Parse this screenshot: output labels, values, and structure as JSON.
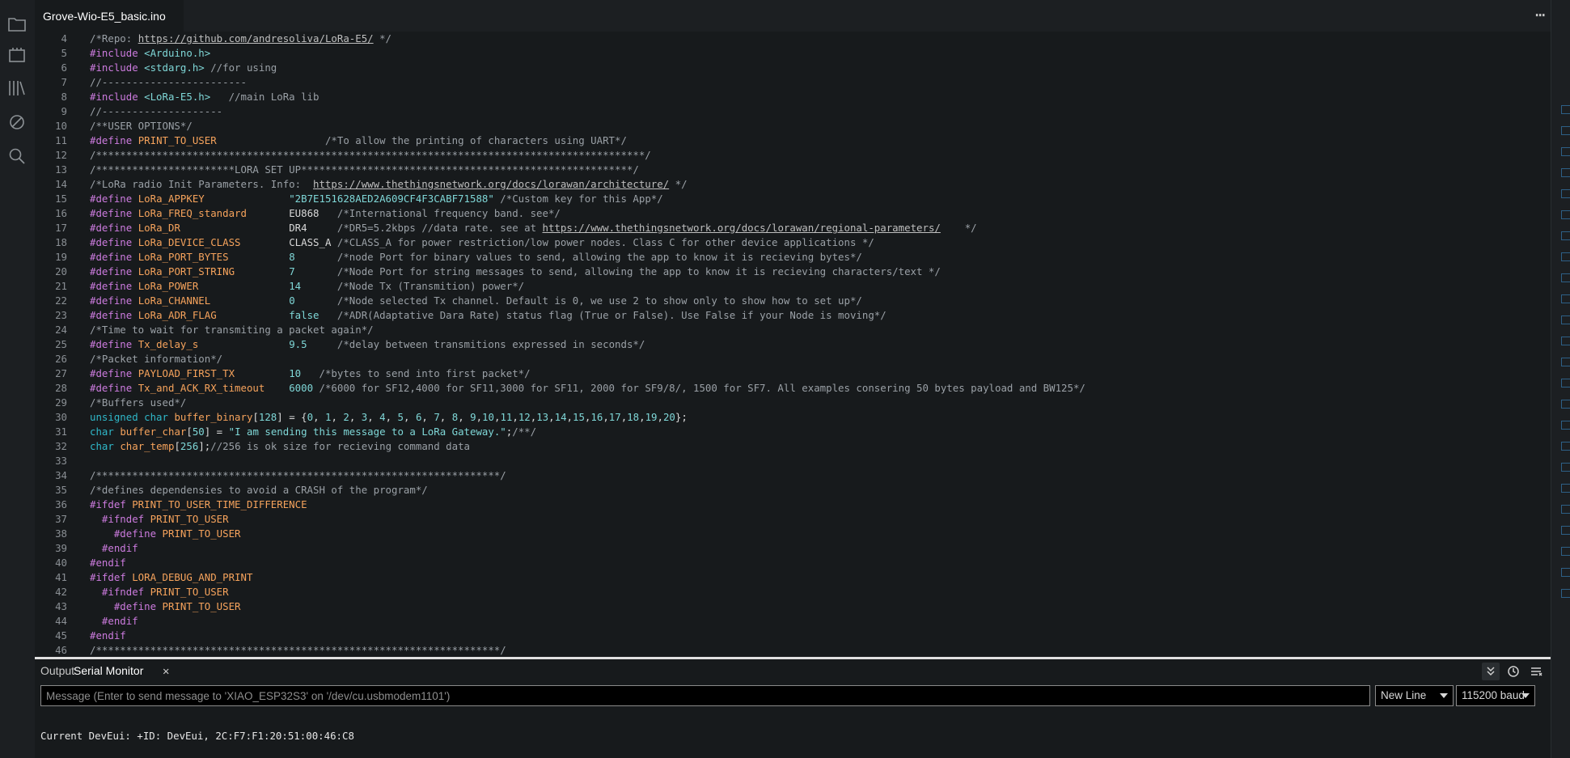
{
  "sidebar": {
    "icons": [
      "folder-icon",
      "board-icon",
      "library-icon",
      "debug-icon",
      "search-icon"
    ]
  },
  "editor": {
    "tab_label": "Grove-Wio-E5_basic.ino",
    "more_label": "⋯",
    "lines": [
      {
        "n": "4",
        "t": [
          [
            "c",
            "/*Repo: "
          ],
          [
            "u",
            "https://github.com/andresoliva/LoRa-E5/"
          ],
          [
            "c",
            " */"
          ]
        ]
      },
      {
        "n": "5",
        "t": [
          [
            "pp",
            "#include "
          ],
          [
            "str",
            "<Arduino.h>"
          ]
        ]
      },
      {
        "n": "6",
        "t": [
          [
            "pp",
            "#include "
          ],
          [
            "str",
            "<stdarg.h>"
          ],
          [
            "c",
            " //for using"
          ]
        ]
      },
      {
        "n": "7",
        "t": [
          [
            "c",
            "//------------------------"
          ]
        ]
      },
      {
        "n": "8",
        "t": [
          [
            "pp",
            "#include "
          ],
          [
            "str",
            "<LoRa-E5.h>"
          ],
          [
            "c",
            "   //main LoRa lib"
          ]
        ]
      },
      {
        "n": "9",
        "t": [
          [
            "c",
            "//--------------------"
          ]
        ]
      },
      {
        "n": "10",
        "t": [
          [
            "c",
            "/**USER OPTIONS*/"
          ]
        ]
      },
      {
        "n": "11",
        "t": [
          [
            "pp",
            "#define "
          ],
          [
            "name",
            "PRINT_TO_USER"
          ],
          [
            "c",
            "                  /*To allow the printing of characters using UART*/"
          ]
        ]
      },
      {
        "n": "12",
        "t": [
          [
            "c",
            "/*******************************************************************************************/"
          ]
        ]
      },
      {
        "n": "13",
        "t": [
          [
            "c",
            "/***********************LORA SET UP*******************************************************/"
          ]
        ]
      },
      {
        "n": "14",
        "t": [
          [
            "c",
            "/*LoRa radio Init Parameters. Info:  "
          ],
          [
            "u",
            "https://www.thethingsnetwork.org/docs/lorawan/architecture/"
          ],
          [
            "c",
            " */"
          ]
        ]
      },
      {
        "n": "15",
        "t": [
          [
            "pp",
            "#define "
          ],
          [
            "name",
            "LoRa_APPKEY              "
          ],
          [
            "str",
            "\"2B7E151628AED2A609CF4F3CABF71588\""
          ],
          [
            "c",
            " /*Custom key for this App*/"
          ]
        ]
      },
      {
        "n": "16",
        "t": [
          [
            "pp",
            "#define "
          ],
          [
            "name",
            "LoRa_FREQ_standard       "
          ],
          [
            "plain",
            "EU868"
          ],
          [
            "c",
            "   /*International frequency band. see*/"
          ]
        ]
      },
      {
        "n": "17",
        "t": [
          [
            "pp",
            "#define "
          ],
          [
            "name",
            "LoRa_DR                  "
          ],
          [
            "plain",
            "DR4"
          ],
          [
            "c",
            "     /*DR5=5.2kbps //data rate. see at "
          ],
          [
            "u",
            "https://www.thethingsnetwork.org/docs/lorawan/regional-parameters/"
          ],
          [
            "c",
            "    */"
          ]
        ]
      },
      {
        "n": "18",
        "t": [
          [
            "pp",
            "#define "
          ],
          [
            "name",
            "LoRa_DEVICE_CLASS        "
          ],
          [
            "plain",
            "CLASS_A"
          ],
          [
            "c",
            " /*CLASS_A for power restriction/low power nodes. Class C for other device applications */"
          ]
        ]
      },
      {
        "n": "19",
        "t": [
          [
            "pp",
            "#define "
          ],
          [
            "name",
            "LoRa_PORT_BYTES          "
          ],
          [
            "num",
            "8"
          ],
          [
            "c",
            "       /*node Port for binary values to send, allowing the app to know it is recieving bytes*/"
          ]
        ]
      },
      {
        "n": "20",
        "t": [
          [
            "pp",
            "#define "
          ],
          [
            "name",
            "LoRa_PORT_STRING         "
          ],
          [
            "num",
            "7"
          ],
          [
            "c",
            "       /*Node Port for string messages to send, allowing the app to know it is recieving characters/text */"
          ]
        ]
      },
      {
        "n": "21",
        "t": [
          [
            "pp",
            "#define "
          ],
          [
            "name",
            "LoRa_POWER               "
          ],
          [
            "num",
            "14"
          ],
          [
            "c",
            "      /*Node Tx (Transmition) power*/"
          ]
        ]
      },
      {
        "n": "22",
        "t": [
          [
            "pp",
            "#define "
          ],
          [
            "name",
            "LoRa_CHANNEL             "
          ],
          [
            "num",
            "0"
          ],
          [
            "c",
            "       /*Node selected Tx channel. Default is 0, we use 2 to show only to show how to set up*/"
          ]
        ]
      },
      {
        "n": "23",
        "t": [
          [
            "pp",
            "#define "
          ],
          [
            "name",
            "LoRa_ADR_FLAG            "
          ],
          [
            "num",
            "false"
          ],
          [
            "c",
            "   /*ADR(Adaptative Dara Rate) status flag (True or False). Use False if your Node is moving*/"
          ]
        ]
      },
      {
        "n": "24",
        "t": [
          [
            "c",
            "/*Time to wait for transmiting a packet again*/"
          ]
        ]
      },
      {
        "n": "25",
        "t": [
          [
            "pp",
            "#define "
          ],
          [
            "name",
            "Tx_delay_s               "
          ],
          [
            "num",
            "9.5"
          ],
          [
            "c",
            "     /*delay between transmitions expressed in seconds*/"
          ]
        ]
      },
      {
        "n": "26",
        "t": [
          [
            "c",
            "/*Packet information*/"
          ]
        ]
      },
      {
        "n": "27",
        "t": [
          [
            "pp",
            "#define "
          ],
          [
            "name",
            "PAYLOAD_FIRST_TX         "
          ],
          [
            "num",
            "10"
          ],
          [
            "c",
            "   /*bytes to send into first packet*/"
          ]
        ]
      },
      {
        "n": "28",
        "t": [
          [
            "pp",
            "#define "
          ],
          [
            "name",
            "Tx_and_ACK_RX_timeout    "
          ],
          [
            "num",
            "6000"
          ],
          [
            "c",
            " /*6000 for SF12,4000 for SF11,3000 for SF11, 2000 for SF9/8/, 1500 for SF7. All examples consering 50 bytes payload and BW125*/"
          ]
        ]
      },
      {
        "n": "29",
        "t": [
          [
            "c",
            "/*Buffers used*/"
          ]
        ]
      },
      {
        "n": "30",
        "t": [
          [
            "kw",
            "unsigned char "
          ],
          [
            "var",
            "buffer_binary"
          ],
          [
            "plain",
            "["
          ],
          [
            "num",
            "128"
          ],
          [
            "plain",
            "] = {"
          ],
          [
            "num",
            "0"
          ],
          [
            "plain",
            ", "
          ],
          [
            "num",
            "1"
          ],
          [
            "plain",
            ", "
          ],
          [
            "num",
            "2"
          ],
          [
            "plain",
            ", "
          ],
          [
            "num",
            "3"
          ],
          [
            "plain",
            ", "
          ],
          [
            "num",
            "4"
          ],
          [
            "plain",
            ", "
          ],
          [
            "num",
            "5"
          ],
          [
            "plain",
            ", "
          ],
          [
            "num",
            "6"
          ],
          [
            "plain",
            ", "
          ],
          [
            "num",
            "7"
          ],
          [
            "plain",
            ", "
          ],
          [
            "num",
            "8"
          ],
          [
            "plain",
            ", "
          ],
          [
            "num",
            "9"
          ],
          [
            "plain",
            ","
          ],
          [
            "num",
            "10"
          ],
          [
            "plain",
            ","
          ],
          [
            "num",
            "11"
          ],
          [
            "plain",
            ","
          ],
          [
            "num",
            "12"
          ],
          [
            "plain",
            ","
          ],
          [
            "num",
            "13"
          ],
          [
            "plain",
            ","
          ],
          [
            "num",
            "14"
          ],
          [
            "plain",
            ","
          ],
          [
            "num",
            "15"
          ],
          [
            "plain",
            ","
          ],
          [
            "num",
            "16"
          ],
          [
            "plain",
            ","
          ],
          [
            "num",
            "17"
          ],
          [
            "plain",
            ","
          ],
          [
            "num",
            "18"
          ],
          [
            "plain",
            ","
          ],
          [
            "num",
            "19"
          ],
          [
            "plain",
            ","
          ],
          [
            "num",
            "20"
          ],
          [
            "plain",
            "};"
          ]
        ]
      },
      {
        "n": "31",
        "t": [
          [
            "kw",
            "char "
          ],
          [
            "var",
            "buffer_char"
          ],
          [
            "plain",
            "["
          ],
          [
            "num",
            "50"
          ],
          [
            "plain",
            "] = "
          ],
          [
            "str",
            "\"I am sending this message to a LoRa Gateway.\""
          ],
          [
            "plain",
            ";"
          ],
          [
            "c",
            "/**/"
          ]
        ]
      },
      {
        "n": "32",
        "t": [
          [
            "kw",
            "char "
          ],
          [
            "var",
            "char_temp"
          ],
          [
            "plain",
            "["
          ],
          [
            "num",
            "256"
          ],
          [
            "plain",
            "];"
          ],
          [
            "c",
            "//256 is ok size for recieving command data"
          ]
        ]
      },
      {
        "n": "33",
        "t": []
      },
      {
        "n": "34",
        "t": [
          [
            "c",
            "/*******************************************************************/"
          ]
        ]
      },
      {
        "n": "35",
        "t": [
          [
            "c",
            "/*defines dependensies to avoid a CRASH of the program*/"
          ]
        ]
      },
      {
        "n": "36",
        "t": [
          [
            "pp",
            "#ifdef "
          ],
          [
            "name",
            "PRINT_TO_USER_TIME_DIFFERENCE"
          ]
        ]
      },
      {
        "n": "37",
        "t": [
          [
            "pp",
            "  #ifndef "
          ],
          [
            "name",
            "PRINT_TO_USER"
          ]
        ]
      },
      {
        "n": "38",
        "t": [
          [
            "pp",
            "    #define "
          ],
          [
            "name",
            "PRINT_TO_USER"
          ]
        ]
      },
      {
        "n": "39",
        "t": [
          [
            "pp",
            "  #endif"
          ]
        ]
      },
      {
        "n": "40",
        "t": [
          [
            "pp",
            "#endif"
          ]
        ]
      },
      {
        "n": "41",
        "t": [
          [
            "pp",
            "#ifdef "
          ],
          [
            "name",
            "LORA_DEBUG_AND_PRINT"
          ]
        ]
      },
      {
        "n": "42",
        "t": [
          [
            "pp",
            "  #ifndef "
          ],
          [
            "name",
            "PRINT_TO_USER"
          ]
        ]
      },
      {
        "n": "43",
        "t": [
          [
            "pp",
            "    #define "
          ],
          [
            "name",
            "PRINT_TO_USER"
          ]
        ]
      },
      {
        "n": "44",
        "t": [
          [
            "pp",
            "  #endif"
          ]
        ]
      },
      {
        "n": "45",
        "t": [
          [
            "pp",
            "#endif"
          ]
        ]
      },
      {
        "n": "46",
        "t": [
          [
            "c",
            "/*******************************************************************/"
          ]
        ]
      }
    ]
  },
  "panel": {
    "tabs": [
      {
        "label": "Output",
        "active": false
      },
      {
        "label": "Serial Monitor",
        "active": true
      }
    ],
    "close_label": "✕",
    "message_placeholder": "Message (Enter to send message to 'XIAO_ESP32S3' on '/dev/cu.usbmodem1101')",
    "line_ending": "New Line",
    "baud_rate": "115200 baud",
    "output_text": "Current DevEui: +ID: DevEui, 2C:F7:F1:20:51:00:46:C8"
  },
  "colors": {
    "accent": "#00979d",
    "preprocessor": "#cc7bde",
    "identifier": "#f6a35c",
    "literal": "#7fd7d7",
    "comment": "#9aa0a6"
  }
}
